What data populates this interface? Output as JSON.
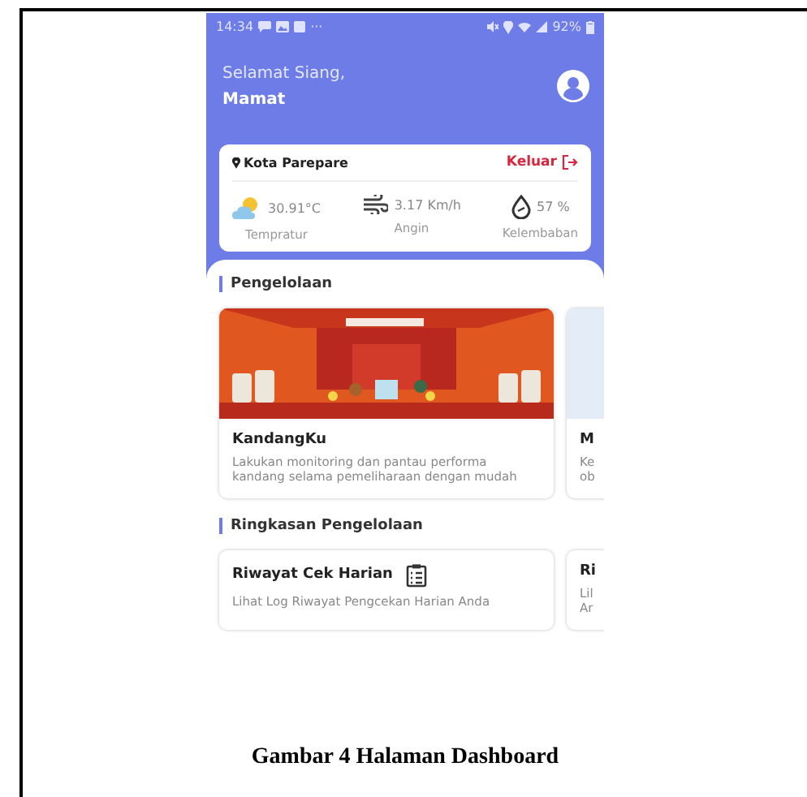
{
  "status_bar": {
    "time": "14:34",
    "more": "···",
    "battery": "92%"
  },
  "header": {
    "greeting": "Selamat Siang,",
    "user": "Mamat"
  },
  "location_card": {
    "city": "Kota Parepare",
    "logout": "Keluar",
    "stats": [
      {
        "kind": "temperature",
        "value": "30.91°C",
        "label": "Tempratur"
      },
      {
        "kind": "wind",
        "value": "3.17 Km/h",
        "label": "Angin"
      },
      {
        "kind": "humidity",
        "value": "57 %",
        "label": "Kelembaban"
      }
    ]
  },
  "sections": [
    {
      "title": "Pengelolaan",
      "kind": "feature",
      "cards": [
        {
          "title": "KandangKu",
          "description": "Lakukan monitoring dan pantau performa kandang selama pemeliharaan dengan mudah"
        },
        {
          "title": "M",
          "description": "Ke ob"
        }
      ]
    },
    {
      "title": "Ringkasan Pengelolaan",
      "kind": "summary",
      "cards": [
        {
          "title": "Riwayat Cek Harian",
          "description": "Lihat Log Riwayat Pengcekan Harian Anda"
        },
        {
          "title": "Ri",
          "description": "Lil Ar"
        }
      ]
    }
  ],
  "caption": "Gambar 4 Halaman Dashboard"
}
